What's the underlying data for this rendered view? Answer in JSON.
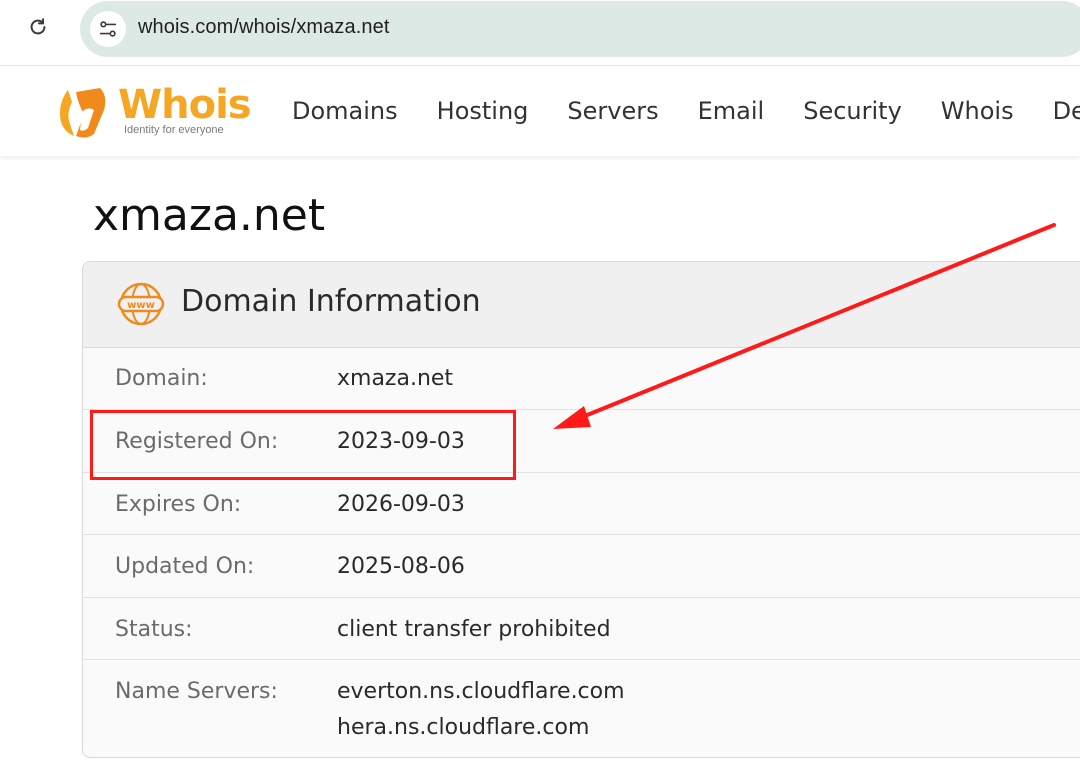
{
  "browser": {
    "url": "whois.com/whois/xmaza.net"
  },
  "site": {
    "logo_word": "Whois",
    "logo_tagline": "Identity for everyone",
    "nav": [
      "Domains",
      "Hosting",
      "Servers",
      "Email",
      "Security",
      "Whois",
      "Deals"
    ]
  },
  "page": {
    "domain_title": "xmaza.net",
    "panel_title": "Domain Information",
    "rows": [
      {
        "label": "Domain:",
        "values": [
          "xmaza.net"
        ]
      },
      {
        "label": "Registered On:",
        "values": [
          "2023-09-03"
        ]
      },
      {
        "label": "Expires On:",
        "values": [
          "2026-09-03"
        ]
      },
      {
        "label": "Updated On:",
        "values": [
          "2025-08-06"
        ]
      },
      {
        "label": "Status:",
        "values": [
          "client transfer prohibited"
        ]
      },
      {
        "label": "Name Servers:",
        "values": [
          "everton.ns.cloudflare.com",
          "hera.ns.cloudflare.com"
        ]
      }
    ]
  },
  "colors": {
    "annotation": "#ff1a1a",
    "brand_orange": "#f5a623",
    "omnibox_bg": "#dde9e4"
  },
  "icons": [
    "reload-icon",
    "site-settings-icon",
    "whois-logo-icon",
    "www-icon"
  ]
}
